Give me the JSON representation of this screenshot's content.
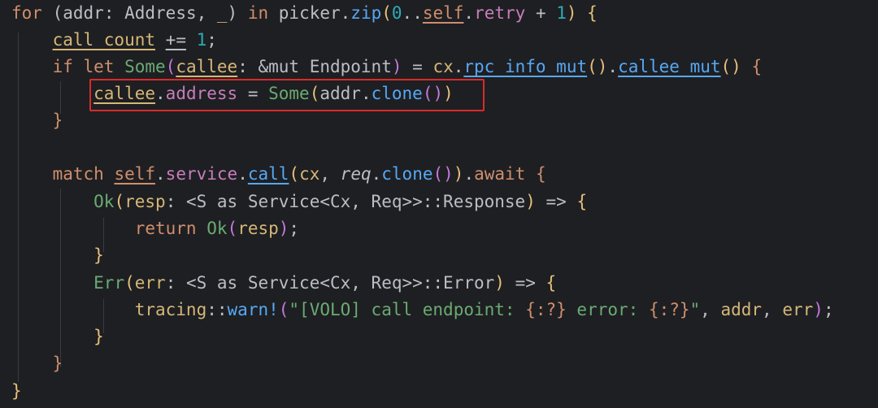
{
  "colors": {
    "background": "#1e1f22",
    "keyword": "#cf8e6d",
    "variable": "#d5b778",
    "function": "#56a8f5",
    "type": "#c77dbb",
    "number": "#2aacb8",
    "string": "#6aab73",
    "highlight": "#d92b2b"
  },
  "lines": [
    {
      "tokens": [
        {
          "text": "for",
          "cls": "kw"
        },
        {
          "text": " (",
          "cls": "id"
        },
        {
          "text": "addr",
          "cls": "id"
        },
        {
          "text": ": Address, ",
          "cls": "id"
        },
        {
          "text": "_",
          "cls": "var"
        },
        {
          "text": ") ",
          "cls": "id"
        },
        {
          "text": "in",
          "cls": "kw"
        },
        {
          "text": " picker.",
          "cls": "id"
        },
        {
          "text": "zip",
          "cls": "fn"
        },
        {
          "text": "(",
          "cls": "b1"
        },
        {
          "text": "0",
          "cls": "num"
        },
        {
          "text": "..",
          "cls": "id"
        },
        {
          "text": "self",
          "cls": "kw"
        },
        {
          "text": ".",
          "cls": "id"
        },
        {
          "text": "retry",
          "cls": "field"
        },
        {
          "text": " + ",
          "cls": "id"
        },
        {
          "text": "1",
          "cls": "num"
        },
        {
          "text": ") {",
          "cls": "b1"
        }
      ]
    },
    {
      "tokens": [
        {
          "text": "    ",
          "cls": "id"
        },
        {
          "text": "call_count",
          "cls": "var"
        },
        {
          "text": " ",
          "cls": "id"
        },
        {
          "text": "+=",
          "cls": "id"
        },
        {
          "text": " ",
          "cls": "id"
        },
        {
          "text": "1",
          "cls": "num"
        },
        {
          "text": ";",
          "cls": "id"
        }
      ]
    },
    {
      "tokens": [
        {
          "text": "    ",
          "cls": "id"
        },
        {
          "text": "if let ",
          "cls": "kw"
        },
        {
          "text": "Some",
          "cls": "str"
        },
        {
          "text": "(",
          "cls": "b2"
        },
        {
          "text": "callee",
          "cls": "var"
        },
        {
          "text": ": &mut Endpoint",
          "cls": "id"
        },
        {
          "text": ")",
          "cls": "b2"
        },
        {
          "text": " = ",
          "cls": "id"
        },
        {
          "text": "cx",
          "cls": "var"
        },
        {
          "text": ".",
          "cls": "id"
        },
        {
          "text": "rpc_info_mut",
          "cls": "fn"
        },
        {
          "text": "()",
          "cls": "b1"
        },
        {
          "text": ".",
          "cls": "id"
        },
        {
          "text": "callee_mut",
          "cls": "fn"
        },
        {
          "text": "()",
          "cls": "b1"
        },
        {
          "text": " {",
          "cls": "kw"
        }
      ]
    },
    {
      "tokens": [
        {
          "text": "        ",
          "cls": "id"
        },
        {
          "text": "callee",
          "cls": "var"
        },
        {
          "text": ".",
          "cls": "id"
        },
        {
          "text": "address",
          "cls": "field"
        },
        {
          "text": " = ",
          "cls": "id"
        },
        {
          "text": "Some",
          "cls": "str"
        },
        {
          "text": "(",
          "cls": "b1"
        },
        {
          "text": "addr",
          "cls": "id"
        },
        {
          "text": ".",
          "cls": "id"
        },
        {
          "text": "clone",
          "cls": "fn"
        },
        {
          "text": "()",
          "cls": "b2"
        },
        {
          "text": ")",
          "cls": "b1"
        }
      ]
    },
    {
      "tokens": [
        {
          "text": "    ",
          "cls": "id"
        },
        {
          "text": "}",
          "cls": "kw"
        }
      ]
    },
    {
      "tokens": []
    },
    {
      "tokens": [
        {
          "text": "    ",
          "cls": "id"
        },
        {
          "text": "match ",
          "cls": "kw"
        },
        {
          "text": "self",
          "cls": "kw"
        },
        {
          "text": ".",
          "cls": "id"
        },
        {
          "text": "service",
          "cls": "field"
        },
        {
          "text": ".",
          "cls": "id"
        },
        {
          "text": "call",
          "cls": "fn"
        },
        {
          "text": "(",
          "cls": "b1"
        },
        {
          "text": "cx",
          "cls": "var"
        },
        {
          "text": ", ",
          "cls": "id"
        },
        {
          "text": "req",
          "cls": "param"
        },
        {
          "text": ".",
          "cls": "id"
        },
        {
          "text": "clone",
          "cls": "fn"
        },
        {
          "text": "()",
          "cls": "b2"
        },
        {
          "text": ")",
          "cls": "b1"
        },
        {
          "text": ".",
          "cls": "id"
        },
        {
          "text": "await",
          "cls": "kw"
        },
        {
          "text": " {",
          "cls": "kw"
        }
      ]
    },
    {
      "tokens": [
        {
          "text": "        ",
          "cls": "id"
        },
        {
          "text": "Ok",
          "cls": "str"
        },
        {
          "text": "(",
          "cls": "b1"
        },
        {
          "text": "resp",
          "cls": "var"
        },
        {
          "text": ": <S as Service<Cx, Req>>::Response",
          "cls": "id"
        },
        {
          "text": ")",
          "cls": "b1"
        },
        {
          "text": " => ",
          "cls": "id"
        },
        {
          "text": "{",
          "cls": "b1"
        }
      ]
    },
    {
      "tokens": [
        {
          "text": "            ",
          "cls": "id"
        },
        {
          "text": "return ",
          "cls": "kw"
        },
        {
          "text": "Ok",
          "cls": "str"
        },
        {
          "text": "(",
          "cls": "b2"
        },
        {
          "text": "resp",
          "cls": "var"
        },
        {
          "text": ")",
          "cls": "b2"
        },
        {
          "text": ";",
          "cls": "id"
        }
      ]
    },
    {
      "tokens": [
        {
          "text": "        ",
          "cls": "id"
        },
        {
          "text": "}",
          "cls": "b1"
        }
      ]
    },
    {
      "tokens": [
        {
          "text": "        ",
          "cls": "id"
        },
        {
          "text": "Err",
          "cls": "str"
        },
        {
          "text": "(",
          "cls": "b1"
        },
        {
          "text": "err",
          "cls": "var"
        },
        {
          "text": ": <S as Service<Cx, Req>>::Error",
          "cls": "id"
        },
        {
          "text": ")",
          "cls": "b1"
        },
        {
          "text": " => ",
          "cls": "id"
        },
        {
          "text": "{",
          "cls": "b1"
        }
      ]
    },
    {
      "tokens": [
        {
          "text": "            ",
          "cls": "id"
        },
        {
          "text": "tracing",
          "cls": "var"
        },
        {
          "text": "::",
          "cls": "id"
        },
        {
          "text": "warn!",
          "cls": "mac"
        },
        {
          "text": "(",
          "cls": "b2"
        },
        {
          "text": "\"[VOLO] call endpoint: ",
          "cls": "str"
        },
        {
          "text": "{:?}",
          "cls": "esc"
        },
        {
          "text": " error: ",
          "cls": "str"
        },
        {
          "text": "{:?}",
          "cls": "esc"
        },
        {
          "text": "\"",
          "cls": "str"
        },
        {
          "text": ", ",
          "cls": "id"
        },
        {
          "text": "addr",
          "cls": "var"
        },
        {
          "text": ", ",
          "cls": "id"
        },
        {
          "text": "err",
          "cls": "var"
        },
        {
          "text": ")",
          "cls": "b2"
        },
        {
          "text": ";",
          "cls": "id"
        }
      ]
    },
    {
      "tokens": [
        {
          "text": "        ",
          "cls": "id"
        },
        {
          "text": "}",
          "cls": "b1"
        }
      ]
    },
    {
      "tokens": [
        {
          "text": "    ",
          "cls": "id"
        },
        {
          "text": "}",
          "cls": "kw"
        }
      ]
    },
    {
      "tokens": [
        {
          "text": "}",
          "cls": "b1"
        }
      ]
    }
  ]
}
